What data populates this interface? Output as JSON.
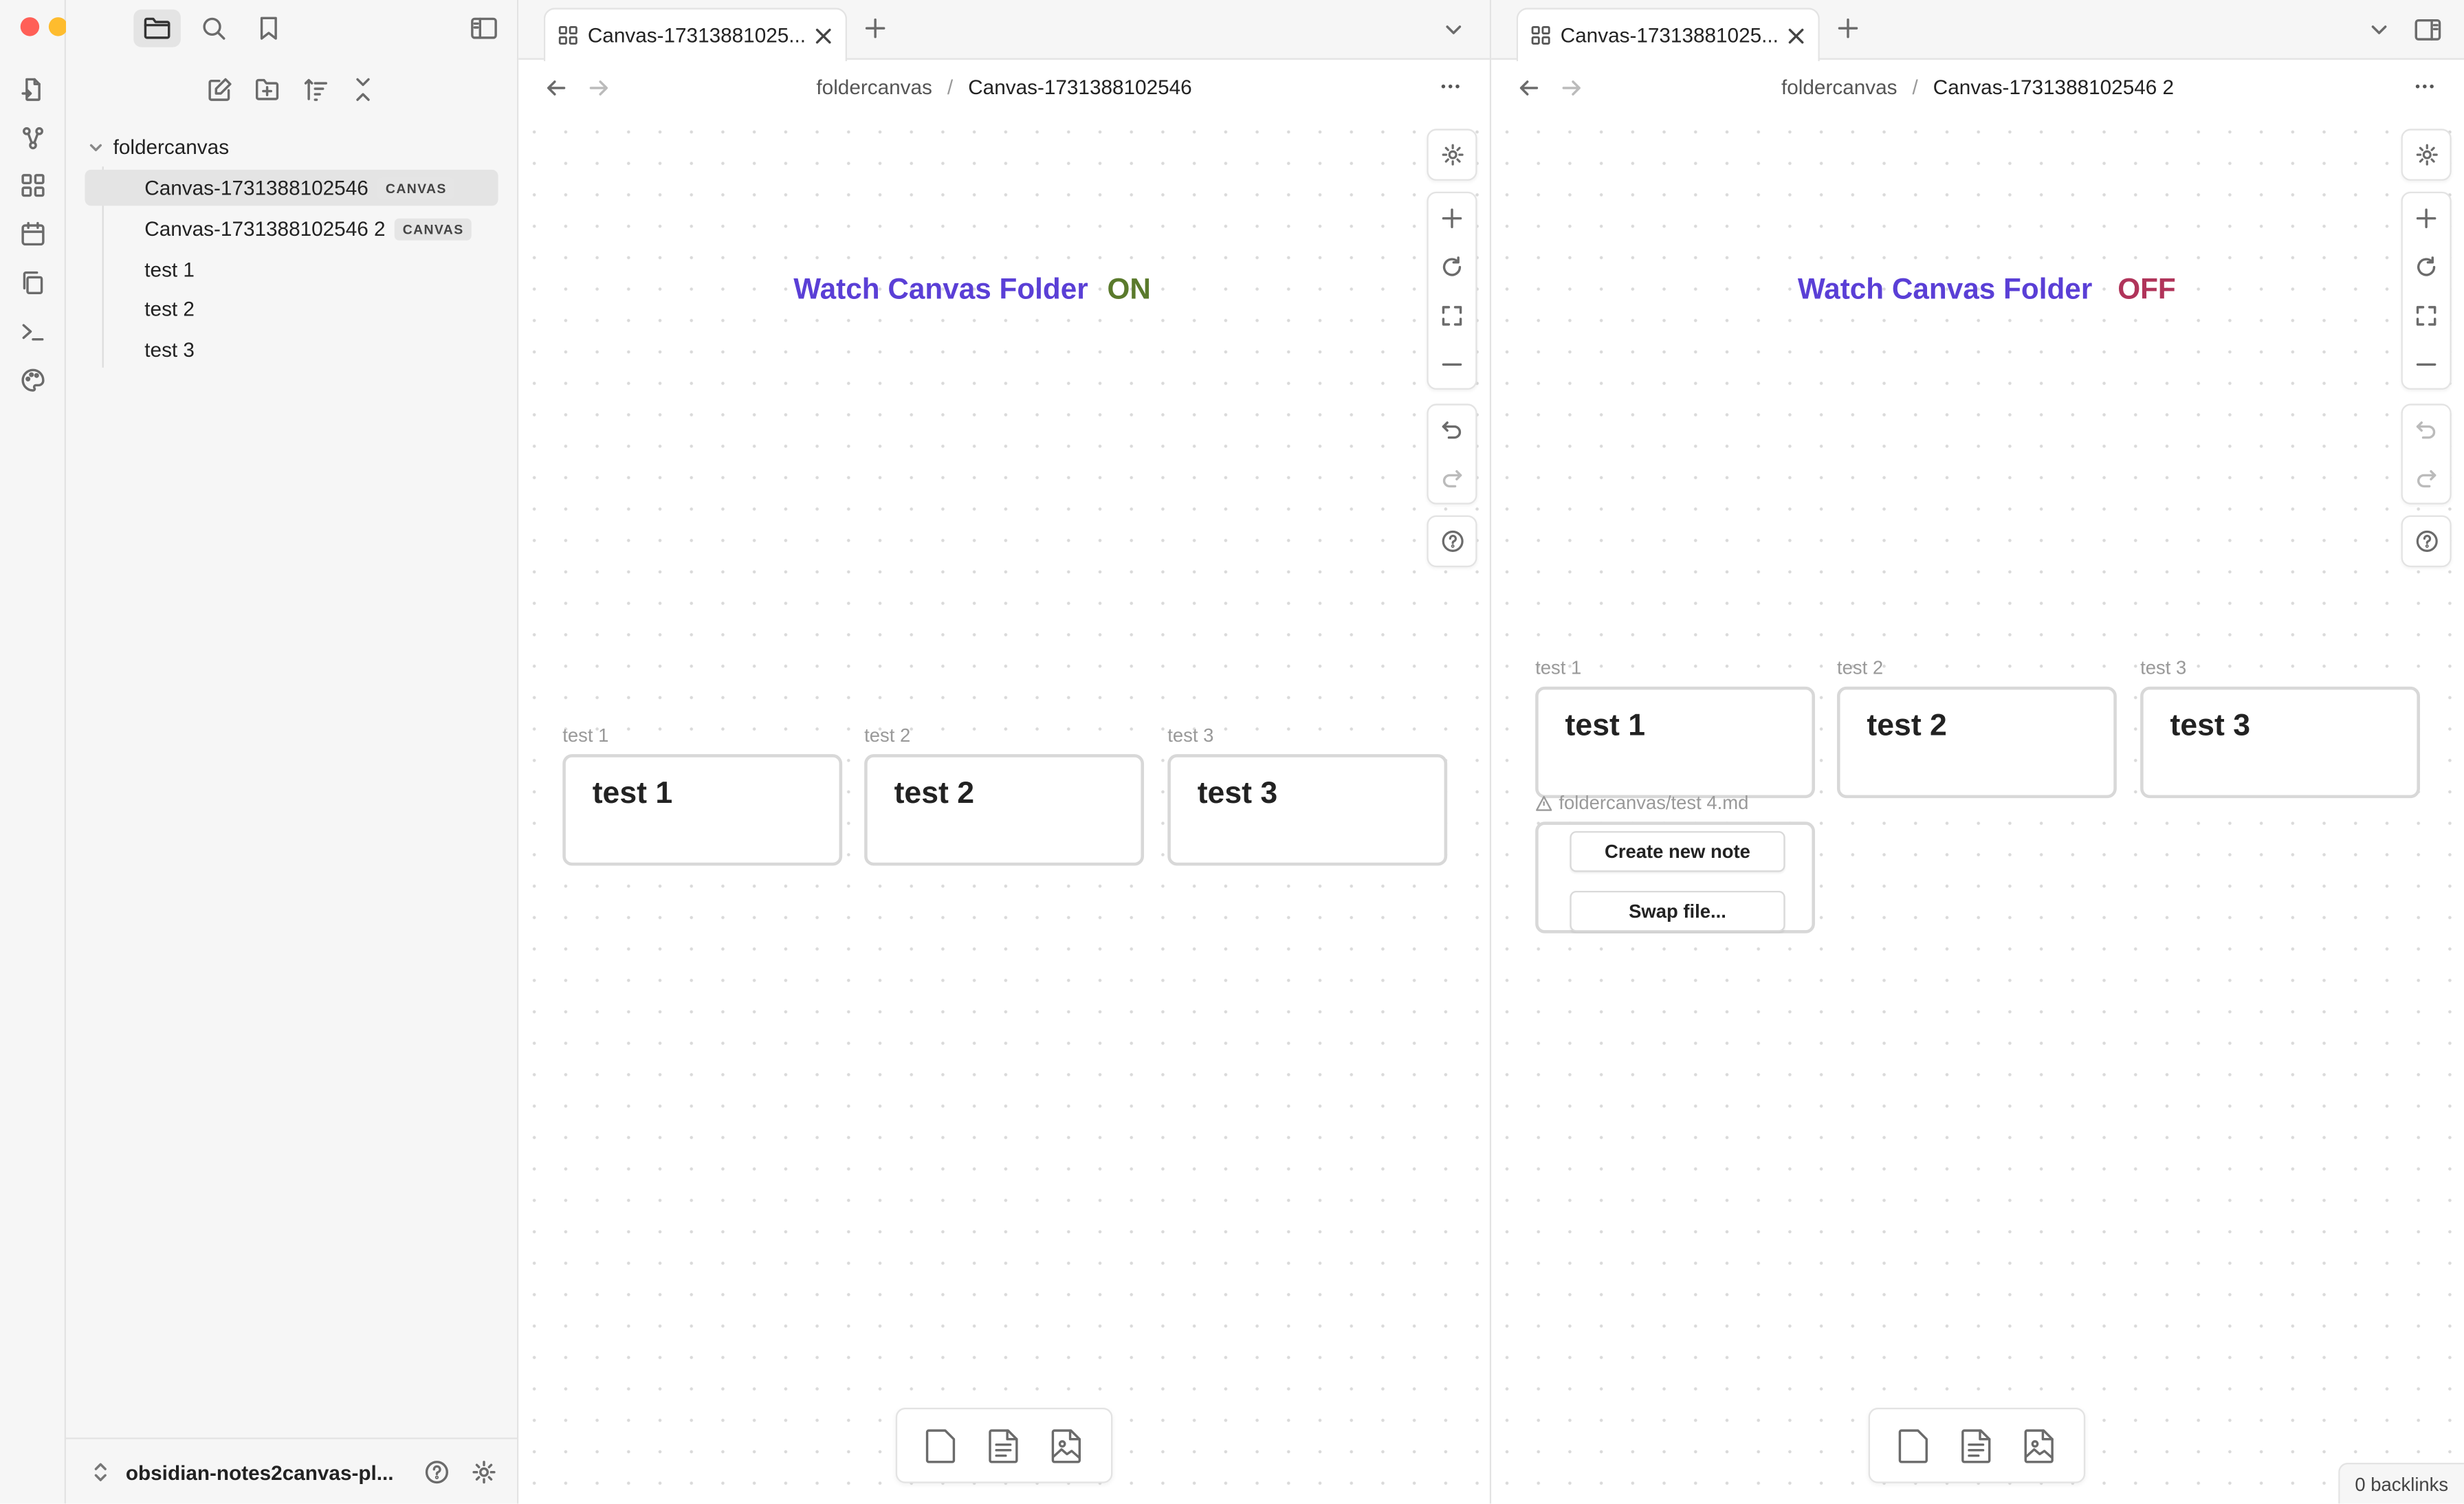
{
  "sidebar": {
    "folder": "foldercanvas",
    "items": [
      {
        "label": "Canvas-1731388102546",
        "badge": "CANVAS"
      },
      {
        "label": "Canvas-1731388102546 2",
        "badge": "CANVAS"
      },
      {
        "label": "test 1"
      },
      {
        "label": "test 2"
      },
      {
        "label": "test 3"
      }
    ],
    "vault": "obsidian-notes2canvas-pl..."
  },
  "left_pane": {
    "tab_title": "Canvas-17313881025...",
    "crumb_folder": "foldercanvas",
    "crumb_sep": "/",
    "crumb_file": "Canvas-1731388102546",
    "watch_label": "Watch Canvas Folder",
    "watch_state": "ON",
    "watch_state_color": "#5a7a2c",
    "nodes": [
      {
        "label": "test 1",
        "text": "test 1"
      },
      {
        "label": "test 2",
        "text": "test 2"
      },
      {
        "label": "test 3",
        "text": "test 3"
      }
    ]
  },
  "right_pane": {
    "tab_title": "Canvas-17313881025...",
    "crumb_folder": "foldercanvas",
    "crumb_sep": "/",
    "crumb_file": "Canvas-1731388102546 2",
    "watch_label": "Watch Canvas Folder",
    "watch_state": "OFF",
    "watch_state_color": "#b0345a",
    "nodes": [
      {
        "label": "test 1",
        "text": "test 1"
      },
      {
        "label": "test 2",
        "text": "test 2"
      },
      {
        "label": "test 3",
        "text": "test 3"
      }
    ],
    "missing_file": {
      "path": "foldercanvas/test 4.md",
      "create_label": "Create new note",
      "swap_label": "Swap file..."
    }
  },
  "status_bar": {
    "backlinks": "0 backlinks"
  },
  "colors": {
    "accent": "#5a3fd6",
    "on": "#5a7a2c",
    "off": "#b0345a"
  }
}
